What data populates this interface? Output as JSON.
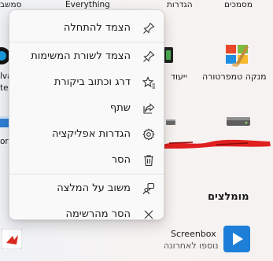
{
  "top_labels": {
    "left": "סמשב",
    "everything": "Everything",
    "settings": "הגדרות",
    "documents": "מסמכים"
  },
  "apps": {
    "left_partial_1": "lva",
    "left_partial_2": "ter",
    "left_partial_3": "ore",
    "weather_partial": "ייעוד",
    "temp_cleaner": "מנקה טמפרטורה"
  },
  "menu": {
    "items": [
      {
        "label": "הצמד להתחלה",
        "icon": "pin-icon"
      },
      {
        "label": "הצמד לשורת המשימות",
        "icon": "pin-icon"
      },
      {
        "label": "דרג וכתוב ביקורת",
        "icon": "star-icon"
      },
      {
        "label": "שתף",
        "icon": "share-icon"
      },
      {
        "label": "הגדרות אפליקציה",
        "icon": "gear-icon"
      },
      {
        "label": "הסר",
        "icon": "trash-icon"
      },
      {
        "label": "משוב על המלצה",
        "icon": "feedback-icon"
      },
      {
        "label": "הסר מהרשימה",
        "icon": "close-icon"
      }
    ]
  },
  "recommended": {
    "heading": "מומלצים",
    "item_title": "Screenbox",
    "item_subtitle": "נוספו לאחרונה"
  }
}
